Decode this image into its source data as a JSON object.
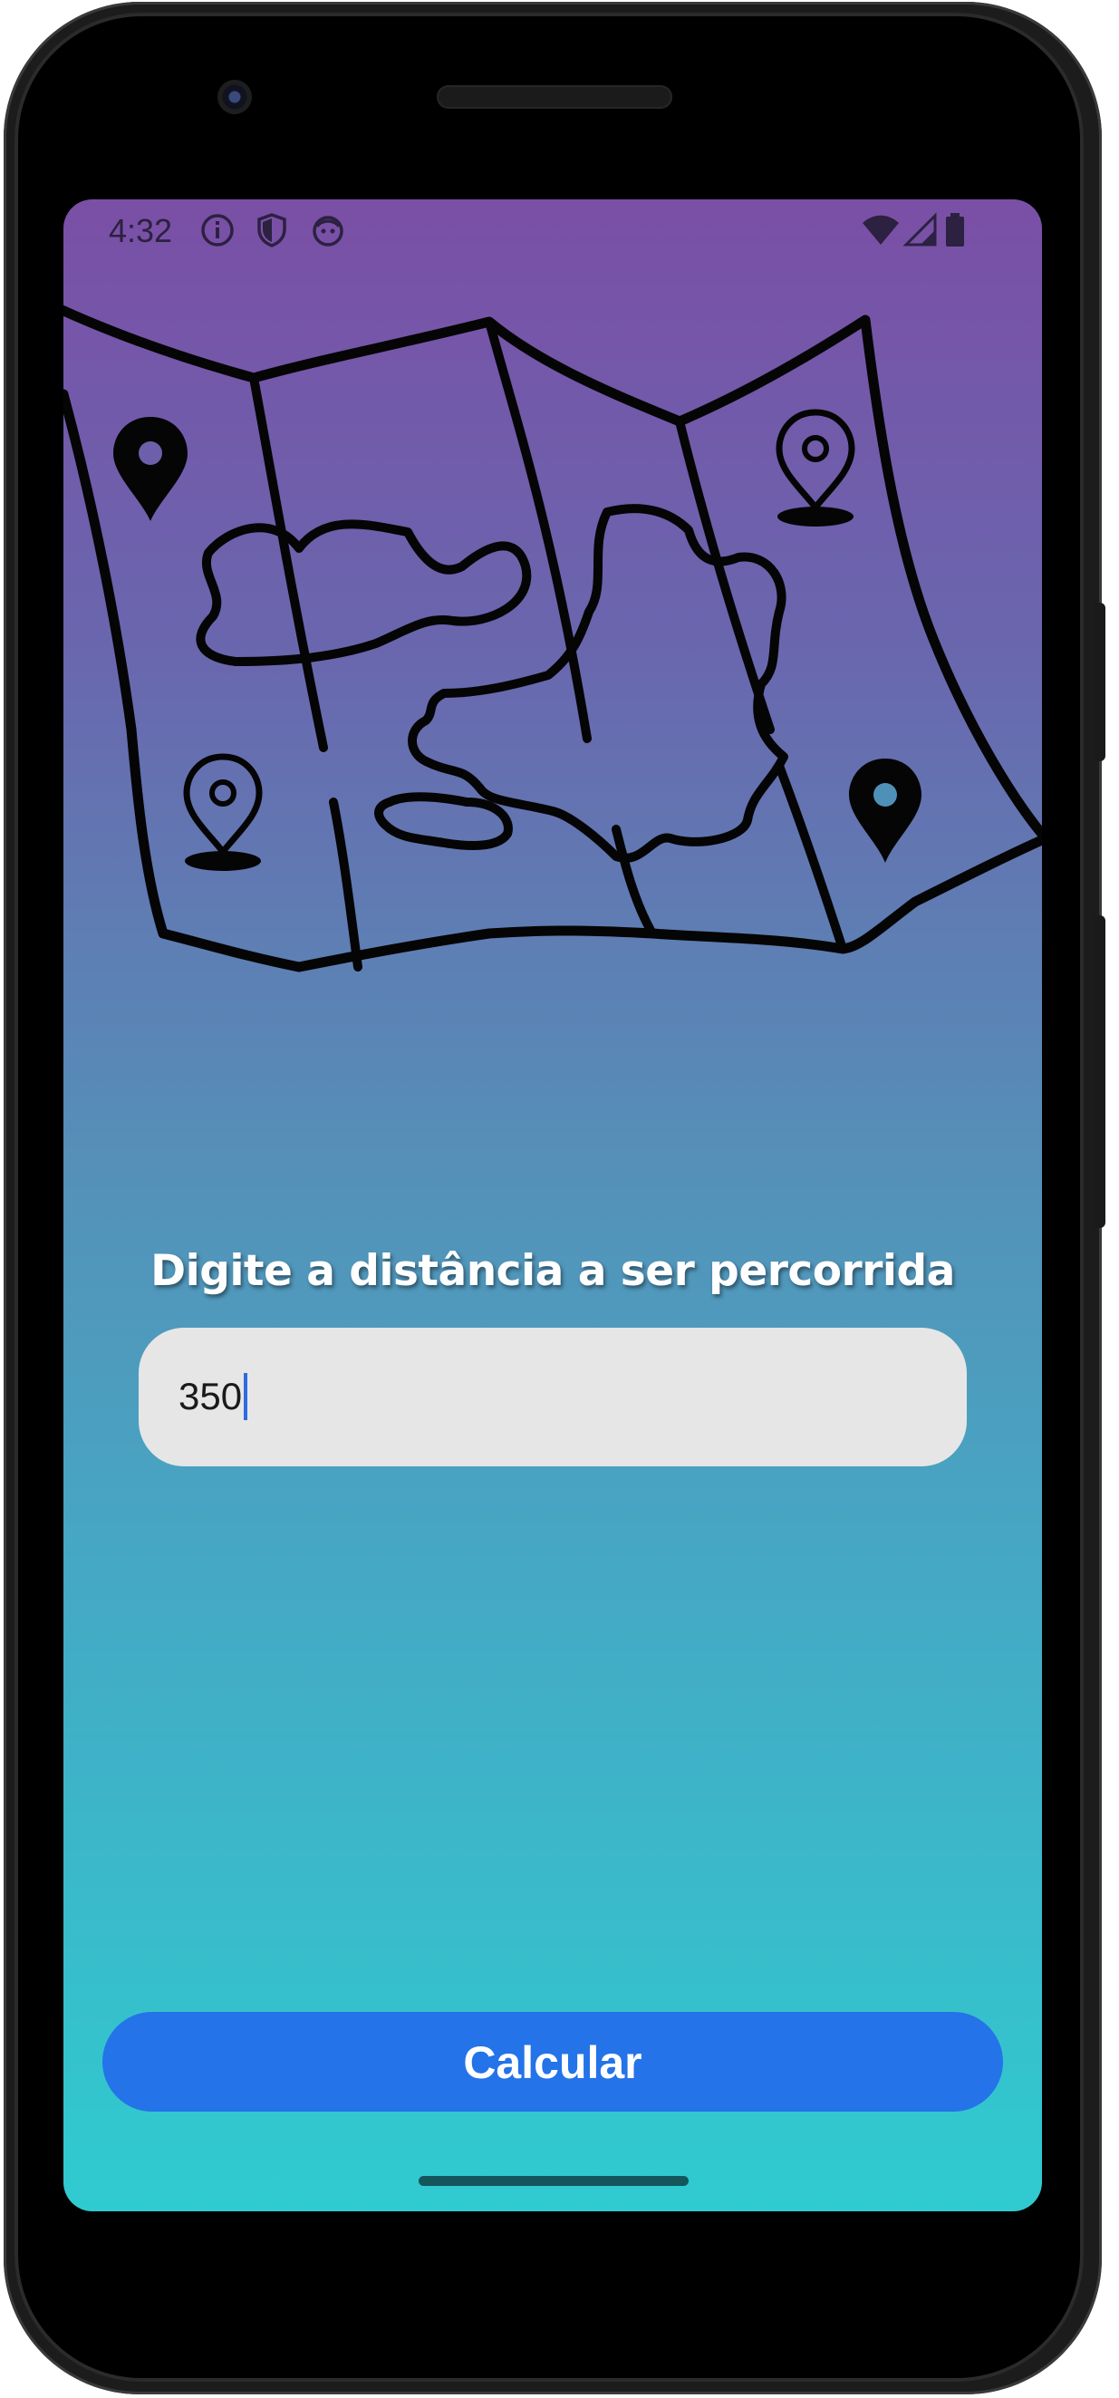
{
  "status_bar": {
    "time": "4:32",
    "left_icons": [
      "info-icon",
      "shield-icon",
      "face-icon"
    ],
    "right_icons": [
      "wifi-icon",
      "signal-icon",
      "battery-icon"
    ]
  },
  "main": {
    "illustration": "map-with-pins-icon",
    "prompt": "Digite a distância a ser percorrida",
    "distance_input": {
      "value": "350"
    },
    "calculate_button": "Calcular"
  },
  "colors": {
    "gradient_top": "#7a4fa6",
    "gradient_bottom": "#2fcbd0",
    "button": "#2473e8",
    "input_bg": "#e6e6e6",
    "cursor": "#2d6be0"
  }
}
